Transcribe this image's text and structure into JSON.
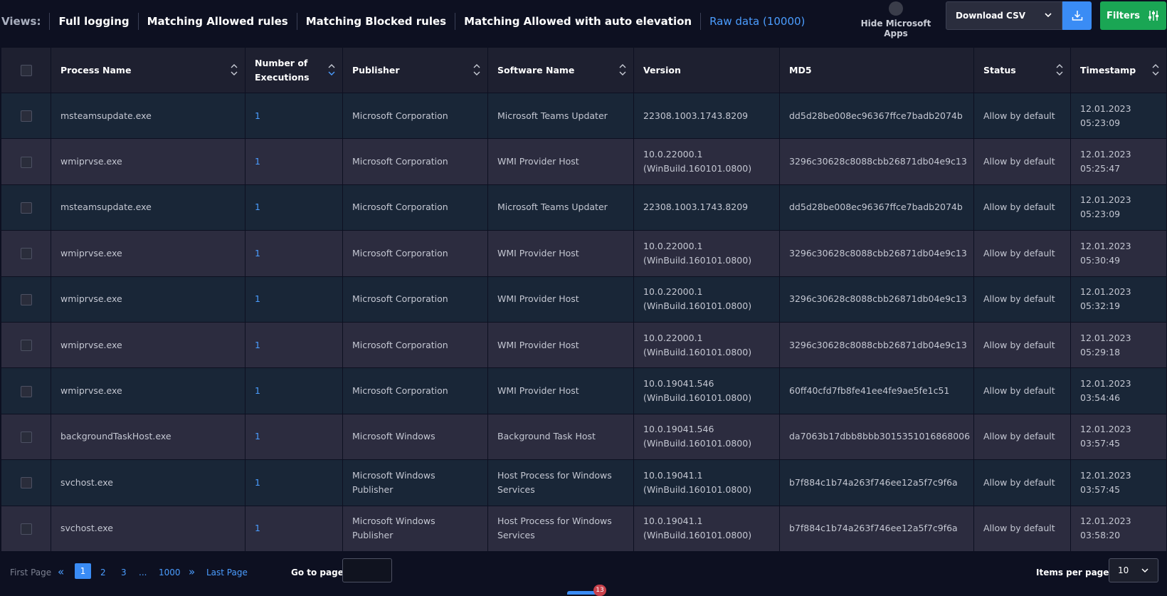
{
  "views": {
    "label": "Views:",
    "tabs": [
      {
        "label": "Full logging"
      },
      {
        "label": "Matching Allowed rules"
      },
      {
        "label": "Matching Blocked rules"
      },
      {
        "label": "Matching Allowed with auto elevation"
      },
      {
        "label": "Raw data (10000)",
        "active": true
      }
    ]
  },
  "toolbar": {
    "hide_ms_label": "Hide Microsoft Apps",
    "download_select": "Download CSV",
    "filters_label": "Filters"
  },
  "table": {
    "columns": [
      "Process Name",
      "Number of Executions",
      "Publisher",
      "Software Name",
      "Version",
      "MD5",
      "Status",
      "Timestamp"
    ],
    "rows": [
      {
        "process": "msteamsupdate.exe",
        "executions": "1",
        "publisher": "Microsoft Corporation",
        "software": "Microsoft Teams Updater",
        "version": "22308.1003.1743.8209",
        "md5": "dd5d28be008ec96367ffce7badb2074b",
        "status": "Allow by default",
        "date": "12.01.2023",
        "time": "05:23:09"
      },
      {
        "process": "wmiprvse.exe",
        "executions": "1",
        "publisher": "Microsoft Corporation",
        "software": "WMI Provider Host",
        "version": "10.0.22000.1 (WinBuild.160101.0800)",
        "md5": "3296c30628c8088cbb26871db04e9c13",
        "status": "Allow by default",
        "date": "12.01.2023",
        "time": "05:25:47"
      },
      {
        "process": "msteamsupdate.exe",
        "executions": "1",
        "publisher": "Microsoft Corporation",
        "software": "Microsoft Teams Updater",
        "version": "22308.1003.1743.8209",
        "md5": "dd5d28be008ec96367ffce7badb2074b",
        "status": "Allow by default",
        "date": "12.01.2023",
        "time": "05:23:09"
      },
      {
        "process": "wmiprvse.exe",
        "executions": "1",
        "publisher": "Microsoft Corporation",
        "software": "WMI Provider Host",
        "version": "10.0.22000.1 (WinBuild.160101.0800)",
        "md5": "3296c30628c8088cbb26871db04e9c13",
        "status": "Allow by default",
        "date": "12.01.2023",
        "time": "05:30:49"
      },
      {
        "process": "wmiprvse.exe",
        "executions": "1",
        "publisher": "Microsoft Corporation",
        "software": "WMI Provider Host",
        "version": "10.0.22000.1 (WinBuild.160101.0800)",
        "md5": "3296c30628c8088cbb26871db04e9c13",
        "status": "Allow by default",
        "date": "12.01.2023",
        "time": "05:32:19"
      },
      {
        "process": "wmiprvse.exe",
        "executions": "1",
        "publisher": "Microsoft Corporation",
        "software": "WMI Provider Host",
        "version": "10.0.22000.1 (WinBuild.160101.0800)",
        "md5": "3296c30628c8088cbb26871db04e9c13",
        "status": "Allow by default",
        "date": "12.01.2023",
        "time": "05:29:18"
      },
      {
        "process": "wmiprvse.exe",
        "executions": "1",
        "publisher": "Microsoft Corporation",
        "software": "WMI Provider Host",
        "version": "10.0.19041.546 (WinBuild.160101.0800)",
        "md5": "60ff40cfd7fb8fe41ee4fe9ae5fe1c51",
        "status": "Allow by default",
        "date": "12.01.2023",
        "time": "03:54:46"
      },
      {
        "process": "backgroundTaskHost.exe",
        "executions": "1",
        "publisher": "Microsoft Windows",
        "software": "Background Task Host",
        "version": "10.0.19041.546 (WinBuild.160101.0800)",
        "md5": "da7063b17dbb8bbb3015351016868006",
        "status": "Allow by default",
        "date": "12.01.2023",
        "time": "03:57:45"
      },
      {
        "process": "svchost.exe",
        "executions": "1",
        "publisher": "Microsoft Windows Publisher",
        "software": "Host Process for Windows Services",
        "version": "10.0.19041.1 (WinBuild.160101.0800)",
        "md5": "b7f884c1b74a263f746ee12a5f7c9f6a",
        "status": "Allow by default",
        "date": "12.01.2023",
        "time": "03:57:45"
      },
      {
        "process": "svchost.exe",
        "executions": "1",
        "publisher": "Microsoft Windows Publisher",
        "software": "Host Process for Windows Services",
        "version": "10.0.19041.1 (WinBuild.160101.0800)",
        "md5": "b7f884c1b74a263f746ee12a5f7c9f6a",
        "status": "Allow by default",
        "date": "12.01.2023",
        "time": "03:58:20"
      }
    ]
  },
  "pagination": {
    "first": "First Page",
    "pages": [
      "1",
      "2",
      "3",
      "...",
      "1000"
    ],
    "current": "1",
    "last": "Last Page",
    "goto_label": "Go to page:",
    "goto_value": "",
    "items_per_page_label": "Items per page:",
    "items_per_page": "10"
  },
  "badge": "13",
  "colors": {
    "accent": "#3a8cf5",
    "filters": "#1aa654",
    "link": "#4b9dff"
  }
}
